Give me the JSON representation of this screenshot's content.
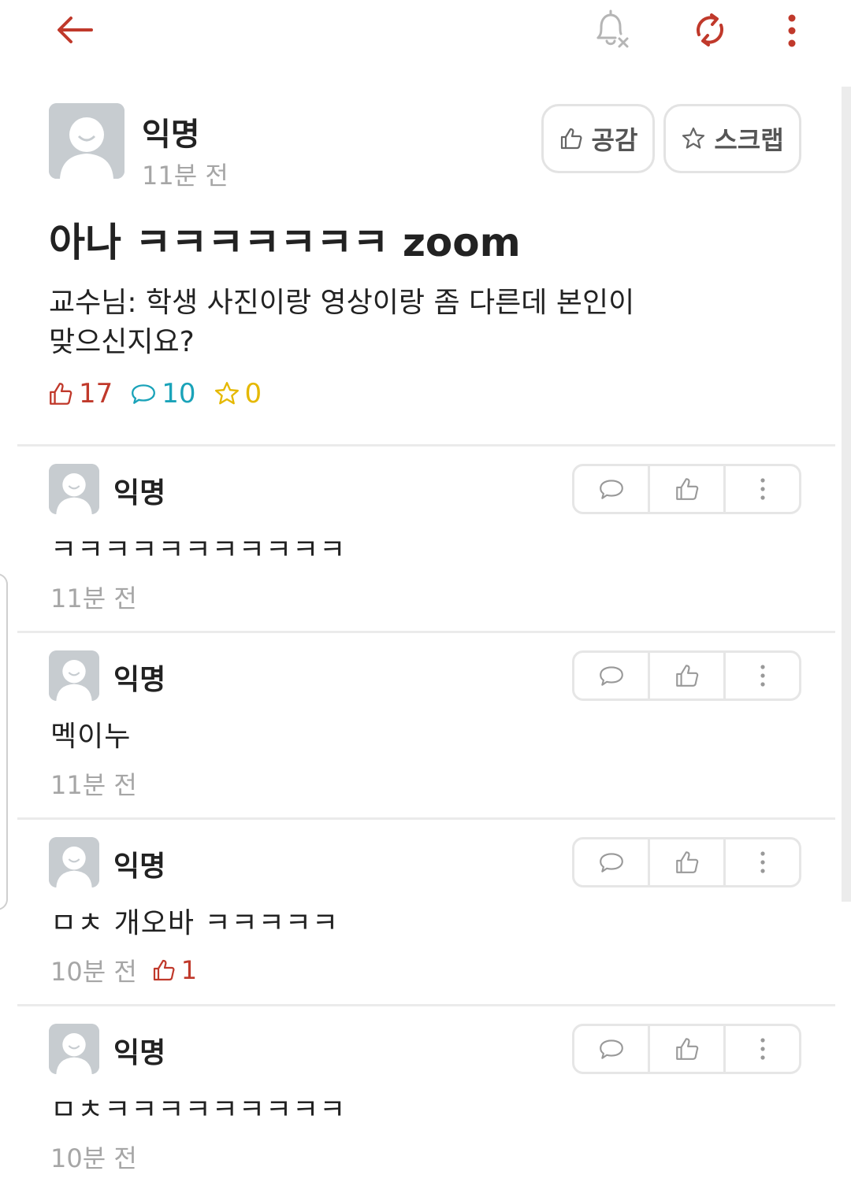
{
  "post": {
    "author": "익명",
    "time": "11분 전",
    "like_button_label": "공감",
    "scrap_button_label": "스크랩",
    "title": "아나 ㅋㅋㅋㅋㅋㅋㅋ zoom",
    "body_line1": "교수님: 학생 사진이랑 영상이랑 좀 다른데 본인이",
    "body_line2": "맞으신지요?",
    "like_count": "17",
    "comment_count": "10",
    "scrap_count": "0"
  },
  "comments": [
    {
      "author": "익명",
      "text": "ㅋㅋㅋㅋㅋㅋㅋㅋㅋㅋㅋ",
      "time": "11분 전",
      "likes": ""
    },
    {
      "author": "익명",
      "text": "멕이누",
      "time": "11분 전",
      "likes": ""
    },
    {
      "author": "익명",
      "text": "ㅁㅊ 개오바 ㅋㅋㅋㅋㅋ",
      "time": "10분 전",
      "likes": "1"
    },
    {
      "author": "익명",
      "text": "ㅁㅊㅋㅋㅋㅋㅋㅋㅋㅋㅋ",
      "time": "10분 전",
      "likes": ""
    }
  ],
  "colors": {
    "accent_red": "#c0392b",
    "comment_teal": "#1aa3b9",
    "scrap_yellow": "#e5b800",
    "muted_gray": "#a6a6a6"
  },
  "icons": [
    "back-arrow-icon",
    "bell-off-icon",
    "refresh-icon",
    "more-vertical-icon",
    "thumbs-up-icon",
    "star-icon",
    "speech-bubble-icon"
  ]
}
